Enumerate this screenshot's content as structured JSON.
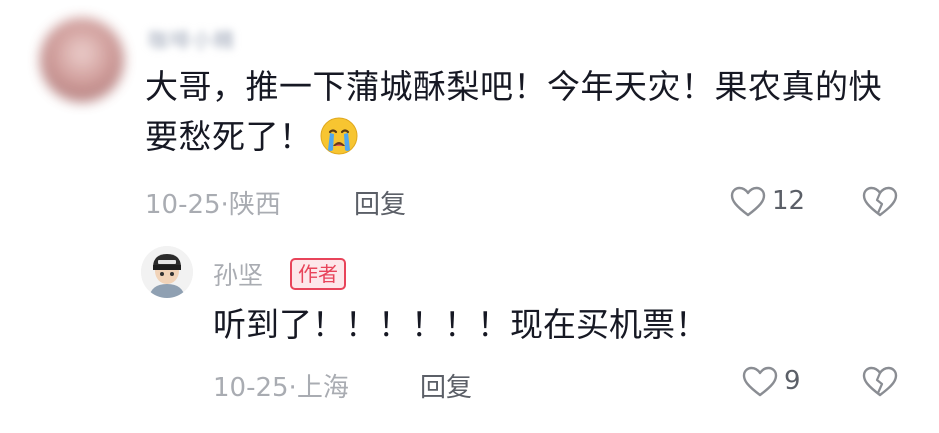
{
  "comment": {
    "username": "咖啡小精",
    "text": "大哥，推一下蒲城酥梨吧！今年天灾！果农真的快要愁死了！",
    "emoji": "crying-face-emoji",
    "date_location": "10-25·陕西",
    "reply_label": "回复",
    "like_count": "12"
  },
  "reply": {
    "author": "孙坚",
    "badge": "作者",
    "text": "听到了！！！！！！现在买机票！",
    "date_location": "10-25·上海",
    "reply_label": "回复",
    "like_count": "9"
  },
  "colors": {
    "text_primary": "#161823",
    "text_meta": "#a9acb2",
    "badge": "#e8445a"
  }
}
